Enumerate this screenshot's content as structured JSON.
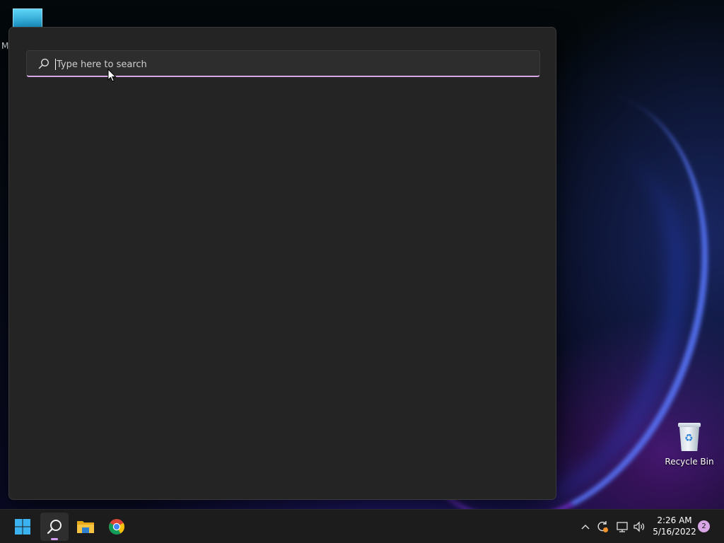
{
  "desktop": {
    "top_icon_letter": "M",
    "recycle_bin_label": "Recycle Bin",
    "top_icon": "app-shortcut-icon"
  },
  "search": {
    "placeholder": "Type here to search",
    "value": "",
    "accent_color": "#d9a6e6",
    "icon": "search-icon"
  },
  "taskbar": {
    "pinned": [
      {
        "name": "start",
        "icon": "windows-logo-icon"
      },
      {
        "name": "search",
        "icon": "search-icon",
        "active": true
      },
      {
        "name": "file-explorer",
        "icon": "folder-icon"
      },
      {
        "name": "chrome",
        "icon": "chrome-icon"
      }
    ],
    "tray": {
      "icons": [
        "chevron-up-icon",
        "update-icon",
        "network-icon",
        "volume-icon"
      ],
      "time": "2:26 AM",
      "date": "5/16/2022",
      "notification_count": "2"
    }
  }
}
